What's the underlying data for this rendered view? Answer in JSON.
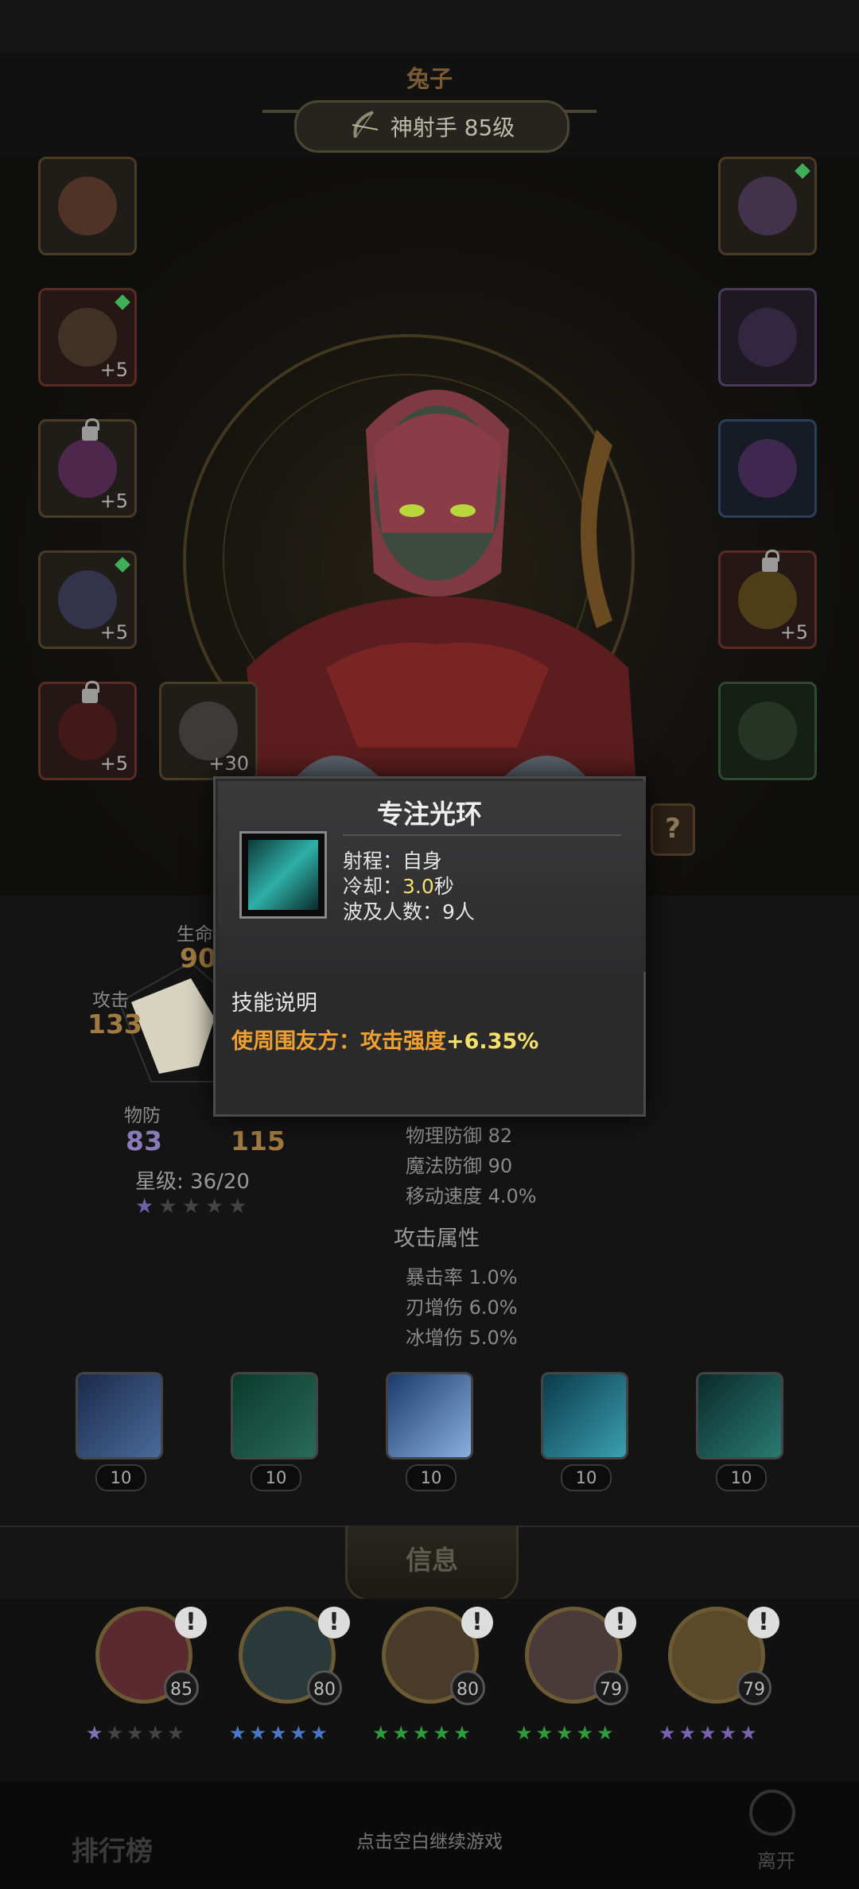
{
  "hero": {
    "name": "兔子",
    "class_level": "神射手 85级"
  },
  "stats": {
    "hp_label": "生命",
    "hp_value": "90",
    "attack_label": "攻击",
    "attack_value": "133",
    "pdef_label": "物防",
    "pdef_value": "83",
    "other_value": "115",
    "star_level": "星级: 36/20"
  },
  "attributes": {
    "defense_lines": [
      "物理防御 82",
      "魔法防御 90",
      "移动速度 4.0%"
    ],
    "attack_title": "攻击属性",
    "attack_lines": [
      "暴击率 1.0%",
      "刃增伤 6.0%",
      "冰增伤 5.0%"
    ]
  },
  "equipment": {
    "left": [
      {
        "plus": "",
        "gem": false,
        "lock": false
      },
      {
        "plus": "+5",
        "gem": true,
        "lock": false
      },
      {
        "plus": "+5",
        "gem": false,
        "lock": true
      },
      {
        "plus": "+5",
        "gem": true,
        "lock": false
      },
      {
        "plus": "+5",
        "gem": false,
        "lock": true
      }
    ],
    "extra_slot_plus": "+30",
    "right": [
      {
        "plus": "",
        "gem": true,
        "lock": false
      },
      {
        "plus": "",
        "gem": false,
        "lock": false
      },
      {
        "plus": "",
        "gem": false,
        "lock": false
      },
      {
        "plus": "+5",
        "gem": false,
        "lock": true
      },
      {
        "plus": "",
        "gem": false,
        "lock": false
      }
    ],
    "help_label": "?"
  },
  "skills": {
    "levels": [
      "10",
      "10",
      "10",
      "10",
      "10"
    ]
  },
  "tabs": {
    "info_label": "信息"
  },
  "roster": {
    "heroes": [
      {
        "level": "85",
        "alert": "!",
        "star_color": "#7c74b8"
      },
      {
        "level": "80",
        "alert": "!",
        "star_color": "#4a78c8"
      },
      {
        "level": "80",
        "alert": "!",
        "star_color": "#2f9c3c"
      },
      {
        "level": "79",
        "alert": "!",
        "star_color": "#2f9c3c"
      },
      {
        "level": "79",
        "alert": "!",
        "star_color": "#7a62b0"
      }
    ]
  },
  "bottom": {
    "continue_hint": "点击空白继续游戏",
    "rank_label": "排行榜",
    "leave_label": "离开"
  },
  "popup": {
    "title": "专注光环",
    "range_label": "射程：",
    "range_value": "自身",
    "cooldown_label": "冷却：",
    "cooldown_value": "3.0",
    "cooldown_unit": "秒",
    "targets_label": "波及人数：",
    "targets_value": "9人",
    "desc_title": "技能说明",
    "desc_prefix": "使周围友方：攻击强度",
    "desc_value": "+6.35%"
  },
  "colors": {
    "accent_gold": "#7a5a34",
    "desc_orange": "#f0a030",
    "highlight_yellow": "#f4e06a"
  },
  "icons": {
    "class_icon": "bow-icon",
    "skill_icons": [
      "arrow-volley-icon",
      "wind-arrow-icon",
      "ice-arrow-icon",
      "vortex-arrow-icon",
      "focus-aura-icon"
    ]
  }
}
